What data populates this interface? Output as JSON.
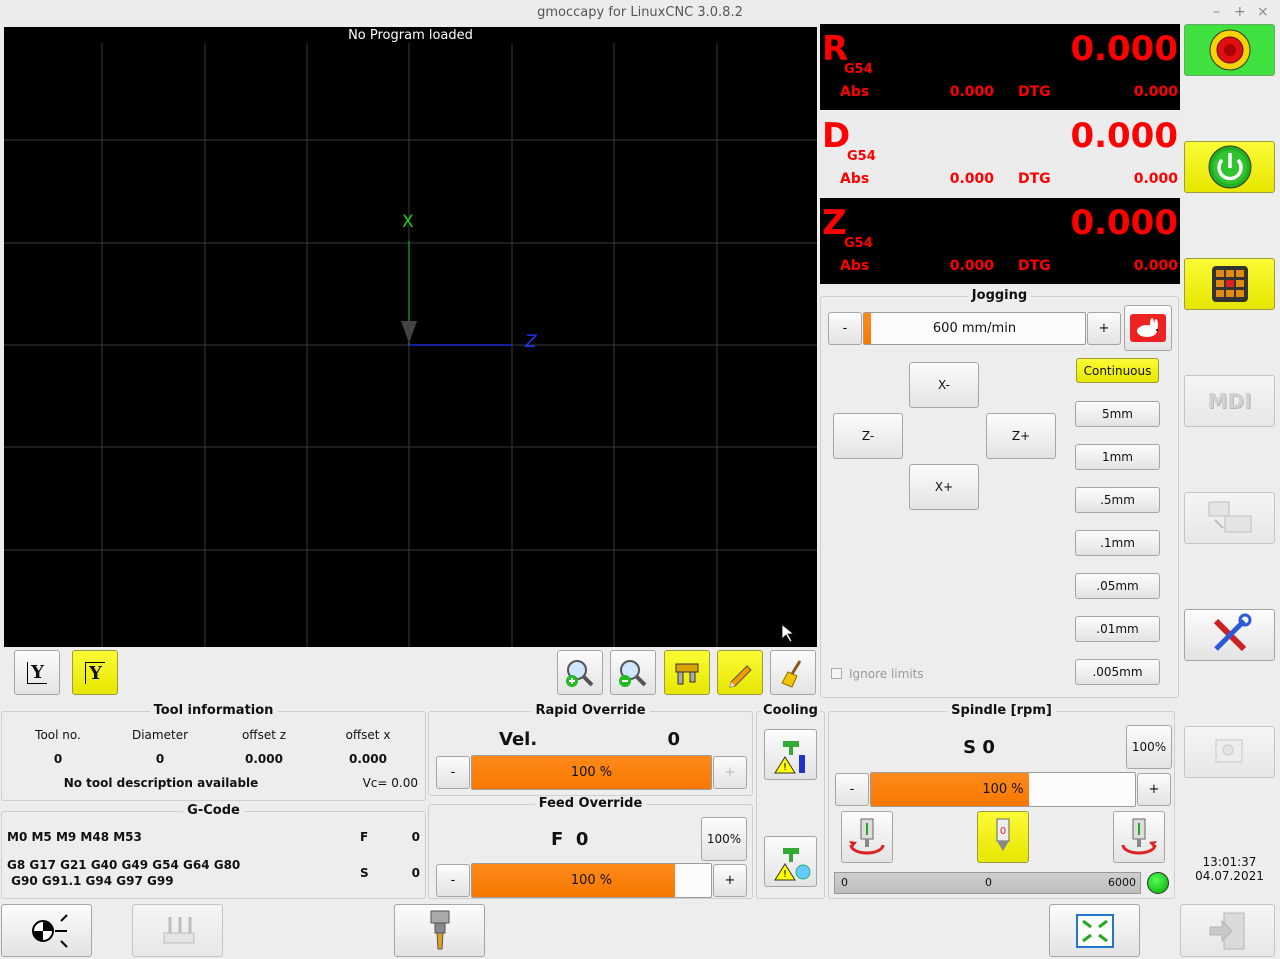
{
  "window": {
    "title": "gmoccapy for LinuxCNC  3.0.8.2",
    "minimize": "–",
    "maximize": "+",
    "close": "×"
  },
  "preview": {
    "title": "No Program loaded",
    "axis_x_label": "X",
    "axis_z_label": "Z"
  },
  "dro": [
    {
      "axis": "R",
      "coord": "G54",
      "value": "0.000",
      "abs_label": "Abs",
      "abs": "0.000",
      "dtg_label": "DTG",
      "dtg": "0.000",
      "bg": "#000000"
    },
    {
      "axis": "D",
      "coord": "G54",
      "value": "0.000",
      "abs_label": "Abs",
      "abs": "0.000",
      "dtg_label": "DTG",
      "dtg": "0.000",
      "bg": "#ececec"
    },
    {
      "axis": "Z",
      "coord": "G54",
      "value": "0.000",
      "abs_label": "Abs",
      "abs": "0.000",
      "dtg_label": "DTG",
      "dtg": "0.000",
      "bg": "#000000"
    }
  ],
  "jogging": {
    "title": "Jogging",
    "minus": "-",
    "plus": "+",
    "speed": "600 mm/min",
    "speed_fraction": 0.03,
    "x_minus": "X-",
    "x_plus": "X+",
    "z_minus": "Z-",
    "z_plus": "Z+",
    "increments": [
      "Continuous",
      "5mm",
      "1mm",
      ".5mm",
      ".1mm",
      ".05mm",
      ".01mm",
      ".005mm"
    ],
    "ignore_limits": "Ignore limits"
  },
  "tool_info": {
    "title": "Tool information",
    "headers": [
      "Tool no.",
      "Diameter",
      "offset z",
      "offset x"
    ],
    "values": [
      "0",
      "0",
      "0.000",
      "0.000"
    ],
    "description": "No tool description available",
    "vc": "Vc= 0.00"
  },
  "gcode": {
    "title": "G-Code",
    "mcodes": "M0 M5 M9 M48 M53",
    "gcodes_line1": "G8 G17 G21 G40 G49 G54 G64 G80",
    "gcodes_line2": " G90 G91.1 G94 G97 G99",
    "f_label": "F",
    "f_value": "0",
    "s_label": "S",
    "s_value": "0"
  },
  "rapid_override": {
    "title": "Rapid Override",
    "vel_label": "Vel.",
    "vel_value": "0",
    "minus": "-",
    "plus": "+",
    "percent": "100 %",
    "fraction": 1.0
  },
  "feed_override": {
    "title": "Feed Override",
    "f_display": "F  0",
    "reset": "100%",
    "minus": "-",
    "plus": "+",
    "percent": "100 %",
    "fraction": 0.85
  },
  "cooling": {
    "title": "Cooling"
  },
  "spindle": {
    "title": "Spindle [rpm]",
    "s_display": "S 0",
    "reset": "100%",
    "minus": "-",
    "plus": "+",
    "percent": "100 %",
    "fraction": 0.6,
    "scale_min": "0",
    "scale_value": "0",
    "scale_max": "6000"
  },
  "clock": {
    "time": "13:01:37",
    "date": "04.07.2021"
  },
  "colors": {
    "accent_orange": "#f77800",
    "yellow": "#f5f500",
    "green": "#22c722",
    "dro_red": "#ff0000"
  }
}
